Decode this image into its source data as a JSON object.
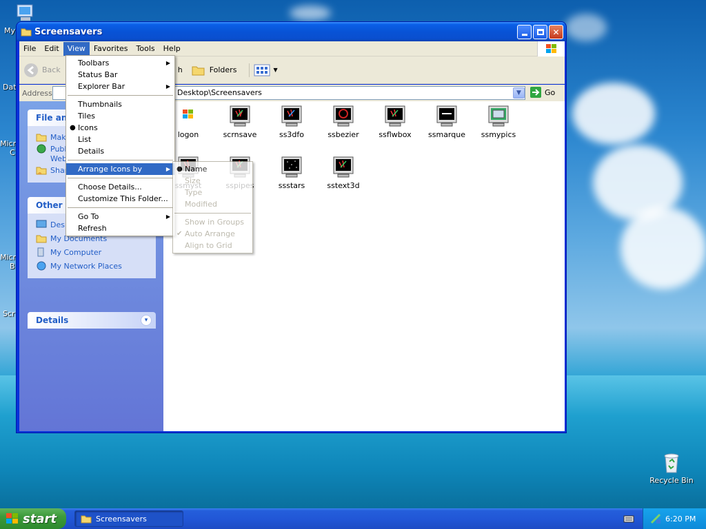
{
  "desktop": {
    "icons": [
      {
        "label": "My"
      },
      {
        "label": "Dat"
      },
      {
        "label": "Micr"
      },
      {
        "label": "C"
      },
      {
        "label": "Micr"
      },
      {
        "label": "B"
      },
      {
        "label": "Scr"
      }
    ],
    "recycle_bin": "Recycle Bin"
  },
  "window": {
    "title": "Screensavers",
    "menu": [
      "File",
      "Edit",
      "View",
      "Favorites",
      "Tools",
      "Help"
    ],
    "toolbar": {
      "back": "Back",
      "folders": "Folders",
      "search_fragment": "h"
    },
    "address": {
      "label": "Address",
      "path": "Desktop\\Screensavers",
      "go": "Go"
    },
    "taskpane": {
      "file_panel_title": "File and",
      "file_links": [
        "Mak",
        "Publ",
        "Web",
        "Shar"
      ],
      "other_panel_title": "Other P",
      "other_links": [
        "Desk",
        "My Documents",
        "My Computer",
        "My Network Places"
      ],
      "details_title": "Details"
    },
    "files": [
      {
        "name": "logon"
      },
      {
        "name": "scrnsave"
      },
      {
        "name": "ss3dfo"
      },
      {
        "name": "ssbezier"
      },
      {
        "name": "ssflwbox"
      },
      {
        "name": "ssmarque"
      },
      {
        "name": "ssmypics"
      },
      {
        "name": "ssmyst"
      },
      {
        "name": "sspipes"
      },
      {
        "name": "ssstars"
      },
      {
        "name": "sstext3d"
      }
    ]
  },
  "view_menu": {
    "items": [
      "Toolbars",
      "Status Bar",
      "Explorer Bar",
      "Thumbnails",
      "Tiles",
      "Icons",
      "List",
      "Details",
      "Arrange Icons by",
      "Choose Details...",
      "Customize This Folder...",
      "Go To",
      "Refresh"
    ],
    "selected": "Icons",
    "highlighted": "Arrange Icons by"
  },
  "arrange_menu": {
    "items": [
      "Name",
      "Size",
      "Type",
      "Modified",
      "Show in Groups",
      "Auto Arrange",
      "Align to Grid"
    ],
    "checked": "Auto Arrange",
    "selected": "Name"
  },
  "taskbar": {
    "start": "start",
    "task": "Screensavers",
    "clock": "6:20 PM"
  },
  "colors": {
    "xp_blue": "#0a5fe8",
    "menu_highlight": "#316ac5",
    "start_green": "#3c9a3b",
    "link_blue": "#215dc6"
  }
}
